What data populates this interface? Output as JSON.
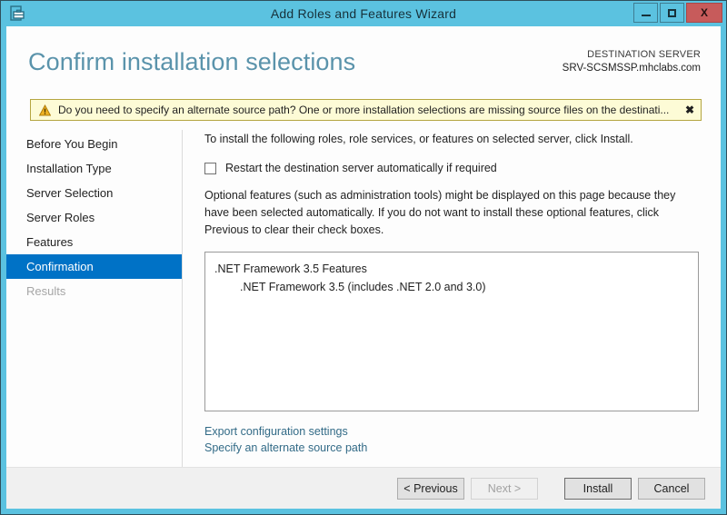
{
  "window": {
    "title": "Add Roles and Features Wizard",
    "icon": "server-wizard-icon",
    "controls": {
      "minimize": "minimize-icon",
      "maximize": "maximize-icon",
      "close_label": "X"
    },
    "frame_color": "#5bc2e0",
    "close_color": "#c75b5b"
  },
  "header": {
    "title": "Confirm installation selections",
    "destination_label": "DESTINATION SERVER",
    "destination_server": "SRV-SCSMSSP.mhclabs.com",
    "title_color": "#5a93ab"
  },
  "notification": {
    "icon": "warning-triangle-icon",
    "text": "Do you need to specify an alternate source path? One or more installation selections are missing source files on the destinati...",
    "close_label": "✖",
    "background": "#fdfbd6",
    "border": "#b5a642"
  },
  "sidebar": {
    "selected_color": "#0072c6",
    "items": [
      {
        "label": "Before You Begin",
        "state": "normal"
      },
      {
        "label": "Installation Type",
        "state": "normal"
      },
      {
        "label": "Server Selection",
        "state": "normal"
      },
      {
        "label": "Server Roles",
        "state": "normal"
      },
      {
        "label": "Features",
        "state": "normal"
      },
      {
        "label": "Confirmation",
        "state": "selected"
      },
      {
        "label": "Results",
        "state": "disabled"
      }
    ]
  },
  "main": {
    "intro_text": "To install the following roles, role services, or features on selected server, click Install.",
    "restart_checkbox_label": "Restart the destination server automatically if required",
    "restart_checkbox_checked": false,
    "optional_text": "Optional features (such as administration tools) might be displayed on this page because they have been selected automatically. If you do not want to install these optional features, click Previous to clear their check boxes.",
    "selections": [
      {
        "label": ".NET Framework 3.5 Features",
        "level": 1
      },
      {
        "label": ".NET Framework 3.5 (includes .NET 2.0 and 3.0)",
        "level": 2
      }
    ],
    "links": [
      {
        "label": "Export configuration settings"
      },
      {
        "label": "Specify an alternate source path"
      }
    ],
    "link_color": "#336b87"
  },
  "footer": {
    "buttons": [
      {
        "label": "< Previous",
        "state": "normal",
        "name": "previous-button"
      },
      {
        "label": "Next >",
        "state": "disabled",
        "name": "next-button"
      },
      {
        "label": "Install",
        "state": "default",
        "name": "install-button"
      },
      {
        "label": "Cancel",
        "state": "normal",
        "name": "cancel-button"
      }
    ]
  }
}
